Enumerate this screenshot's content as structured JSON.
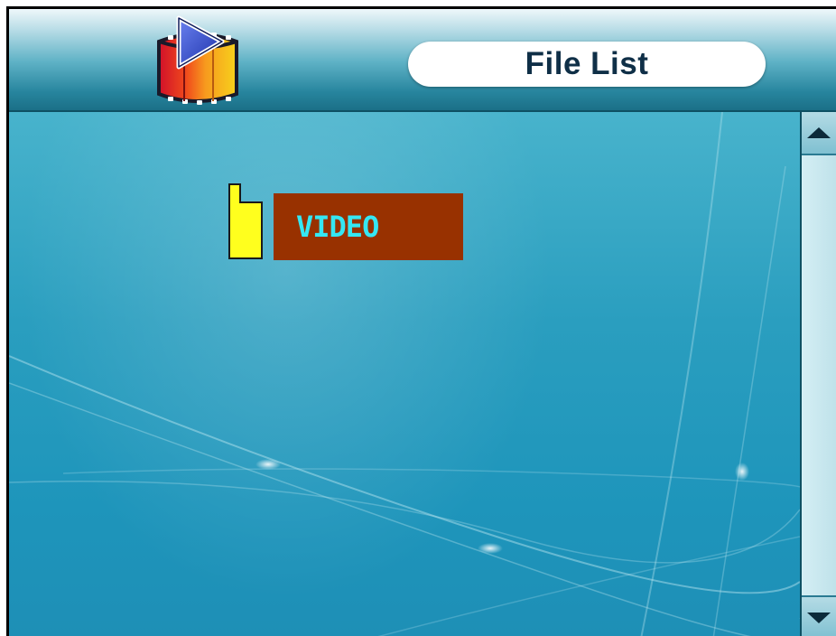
{
  "header": {
    "title": "File List",
    "app_icon": "video-player-icon"
  },
  "file_list": {
    "items": [
      {
        "label": "VIDEO",
        "icon": "folder-icon",
        "selected": true
      }
    ]
  },
  "scrollbar": {
    "up_icon": "arrow-up-icon",
    "down_icon": "arrow-down-icon"
  },
  "colors": {
    "header_gradient_top": "#eef7fa",
    "header_gradient_bottom": "#1b6f87",
    "background": "#1e93b5",
    "selection_bg": "#983100",
    "selection_text": "#35e7f3",
    "folder_icon": "#ffff1e",
    "title_text": "#0f2f47"
  }
}
